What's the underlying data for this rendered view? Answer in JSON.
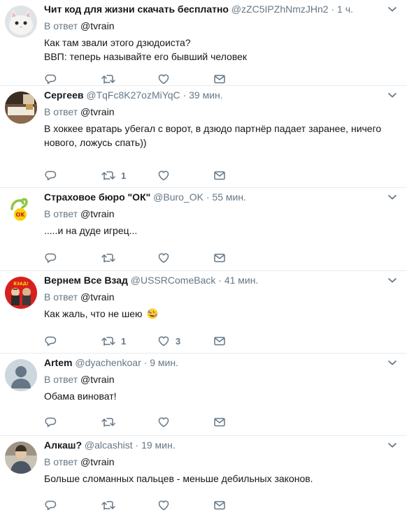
{
  "reply_prefix": "В ответ",
  "tweets": [
    {
      "name": "Чит код для жизни скачать бесплатно",
      "handle": "@zZC5IPZhNmzJHn2",
      "dot": "·",
      "time": "1 ч.",
      "mention": "@tvrain",
      "text_lines": [
        "Как там звали этого дзюдоиста?",
        "ВВП: теперь называйте его бывший человек"
      ],
      "retweets": "",
      "likes": "",
      "avatar": "cat"
    },
    {
      "name": "Сергеев",
      "handle": "@TqFc8K27ozMiYqC",
      "dot": "·",
      "time": "39 мин.",
      "mention": "@tvrain",
      "text_lines": [
        "В хоккее вратарь убегал с ворот, в дзюдо партнёр падает заранее, ничего",
        "нового, ложусь спать))"
      ],
      "retweets": "1",
      "likes": "",
      "avatar": "room"
    },
    {
      "name": "Страховое бюро \"ОК\"",
      "handle": "@Buro_OK",
      "dot": "·",
      "time": "55 мин.",
      "mention": "@tvrain",
      "text_lines": [
        ".....и на дуде игрец..."
      ],
      "retweets": "",
      "likes": "",
      "avatar": "ok-logo"
    },
    {
      "name": "Вернем Все Взад",
      "handle": "@USSRComeBack",
      "dot": "·",
      "time": "41 мин.",
      "mention": "@tvrain",
      "text_lines": [
        "Как жаль, что не шею"
      ],
      "retweets": "1",
      "likes": "3",
      "avatar": "red-poster"
    },
    {
      "name": "Artem",
      "handle": "@dyachenkoar",
      "dot": "·",
      "time": "9 мин.",
      "mention": "@tvrain",
      "text_lines": [
        "Обама виноват!"
      ],
      "retweets": "",
      "likes": "",
      "avatar": "default"
    },
    {
      "name": "Алкаш?",
      "handle": "@alcashist",
      "dot": "·",
      "time": "19 мин.",
      "mention": "@tvrain",
      "text_lines": [
        "Больше сломанных пальцев - меньше дебильных законов."
      ],
      "retweets": "",
      "likes": "",
      "avatar": "person-photo"
    }
  ],
  "colors": {
    "text": "#14171a",
    "muted": "#657786",
    "divider": "#e6ecf0",
    "default_avatar": "#ccd6dd"
  },
  "icons": [
    "reply-icon",
    "retweet-icon",
    "like-icon",
    "direct-message-icon",
    "chevron-down-icon",
    "rolling-laughing-emoji"
  ]
}
